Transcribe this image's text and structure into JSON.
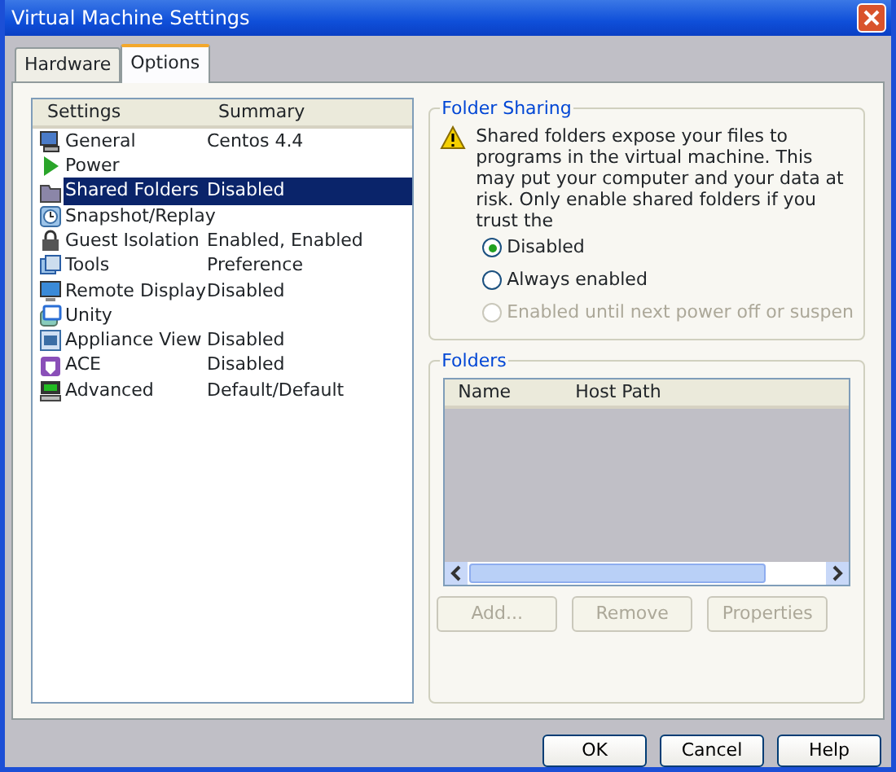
{
  "window": {
    "title": "Virtual Machine Settings"
  },
  "tabs": [
    {
      "label": "Hardware",
      "selected": false
    },
    {
      "label": "Options",
      "selected": true
    }
  ],
  "settings_list": {
    "columns": [
      "Settings",
      "Summary"
    ],
    "rows": [
      {
        "name": "General",
        "summary": "Centos 4.4",
        "selected": false
      },
      {
        "name": "Power",
        "summary": "",
        "selected": false
      },
      {
        "name": "Shared Folders",
        "summary": "Disabled",
        "selected": true
      },
      {
        "name": "Snapshot/Replay",
        "summary": "",
        "selected": false
      },
      {
        "name": "Guest Isolation",
        "summary": "Enabled, Enabled",
        "selected": false
      },
      {
        "name": "Tools",
        "summary": "Preference",
        "selected": false
      },
      {
        "name": "Remote Display",
        "summary": "Disabled",
        "selected": false
      },
      {
        "name": "Unity",
        "summary": "",
        "selected": false
      },
      {
        "name": "Appliance View",
        "summary": "Disabled",
        "selected": false
      },
      {
        "name": "ACE",
        "summary": "Disabled",
        "selected": false
      },
      {
        "name": "Advanced",
        "summary": "Default/Default",
        "selected": false
      }
    ]
  },
  "folder_sharing": {
    "title": "Folder Sharing",
    "warning": "Shared folders expose your files to programs in the virtual machine. This may put your computer and your data at risk. Only enable shared folders if you trust the",
    "options": [
      {
        "label": "Disabled",
        "selected": true,
        "disabled": false
      },
      {
        "label": "Always enabled",
        "selected": false,
        "disabled": false
      },
      {
        "label": "Enabled until next power off or suspen",
        "selected": false,
        "disabled": true
      }
    ]
  },
  "folders": {
    "title": "Folders",
    "columns": [
      "Name",
      "Host Path"
    ],
    "buttons": [
      {
        "label": "Add...",
        "disabled": true
      },
      {
        "label": "Remove",
        "disabled": true
      },
      {
        "label": "Properties",
        "disabled": true
      }
    ]
  },
  "buttons": [
    "OK",
    "Cancel",
    "Help"
  ]
}
